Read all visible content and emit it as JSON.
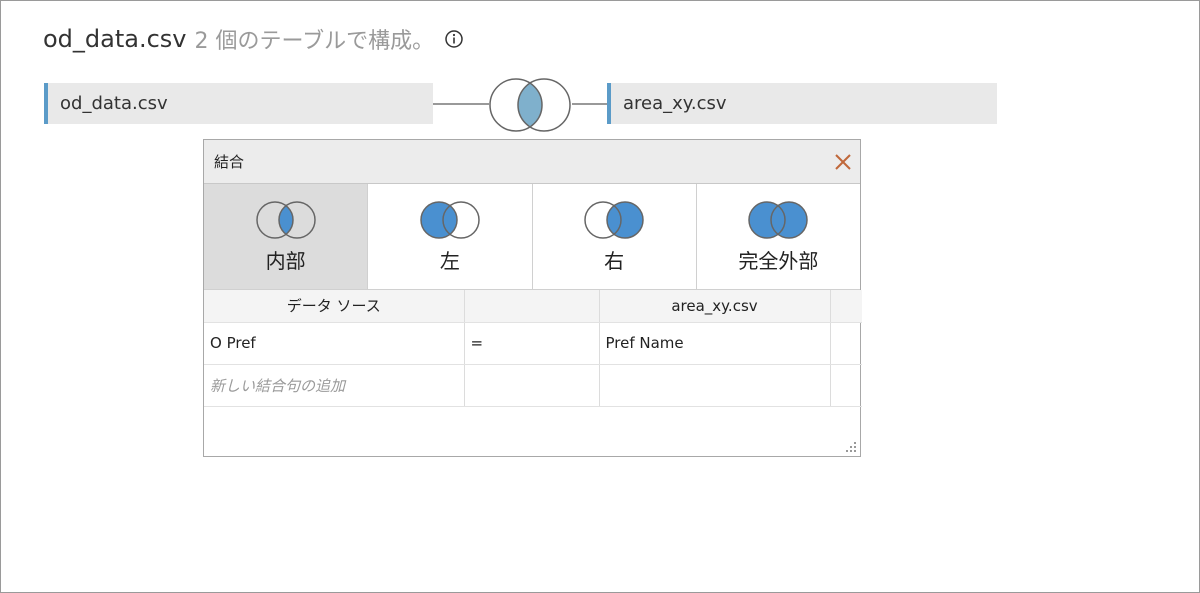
{
  "header": {
    "datasource_name": "od_data.csv",
    "subtitle": "2 個のテーブルで構成。"
  },
  "canvas": {
    "left_table": "od_data.csv",
    "right_table": "area_xy.csv"
  },
  "join_dialog": {
    "title": "結合",
    "join_types": [
      {
        "label": "内部",
        "selected": true
      },
      {
        "label": "左",
        "selected": false
      },
      {
        "label": "右",
        "selected": false
      },
      {
        "label": "完全外部",
        "selected": false
      }
    ],
    "columns": {
      "left_header": "データ ソース",
      "operator_header": "",
      "right_header": "area_xy.csv"
    },
    "clauses": [
      {
        "left": "O Pref",
        "operator": "=",
        "right": "Pref Name"
      }
    ],
    "add_clause_placeholder": "新しい結合句の追加"
  },
  "colors": {
    "venn_fill": "#4a90d0",
    "venn_overlap_main": "#7fb0cc",
    "accent_bar": "#5b9bc8",
    "close": "#c0683a"
  }
}
